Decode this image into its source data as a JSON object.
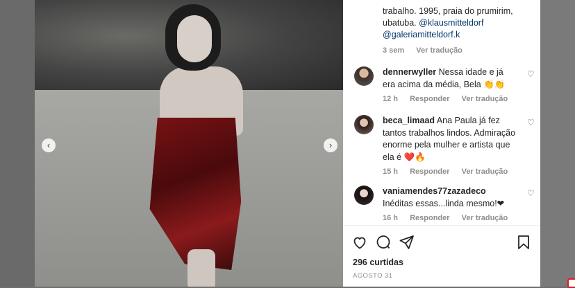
{
  "caption": {
    "line1": "trabalho. 1995, praia do prumirim,",
    "line2": "ubatuba.",
    "tag1": "@klausmitteldorf",
    "tag2": "@galeriamitteldorf.k",
    "time": "3 sem",
    "translate": "Ver tradução"
  },
  "comments": [
    {
      "user": "dennerwyller",
      "text": "Nessa idade e já era acima da média, Bela 👏👏",
      "time": "12 h",
      "reply": "Responder",
      "translate": "Ver tradução"
    },
    {
      "user": "beca_limaad",
      "text": "Ana Paula já fez tantos trabalhos lindos. Admiração enorme pela mulher e artista que ela é ❤️🔥",
      "time": "15 h",
      "reply": "Responder",
      "translate": "Ver tradução"
    },
    {
      "user": "vaniamendes77zazadeco",
      "text": "Inéditas essas...linda mesmo!❤",
      "time": "16 h",
      "reply": "Responder",
      "translate": "Ver tradução"
    }
  ],
  "stats": {
    "likes": "296 curtidas",
    "date": "AGOSTO 31"
  },
  "nav": {
    "prev": "‹",
    "next": "›"
  },
  "colors": {
    "link": "#00376b",
    "meta": "#8e8e8e",
    "text": "#262626"
  }
}
